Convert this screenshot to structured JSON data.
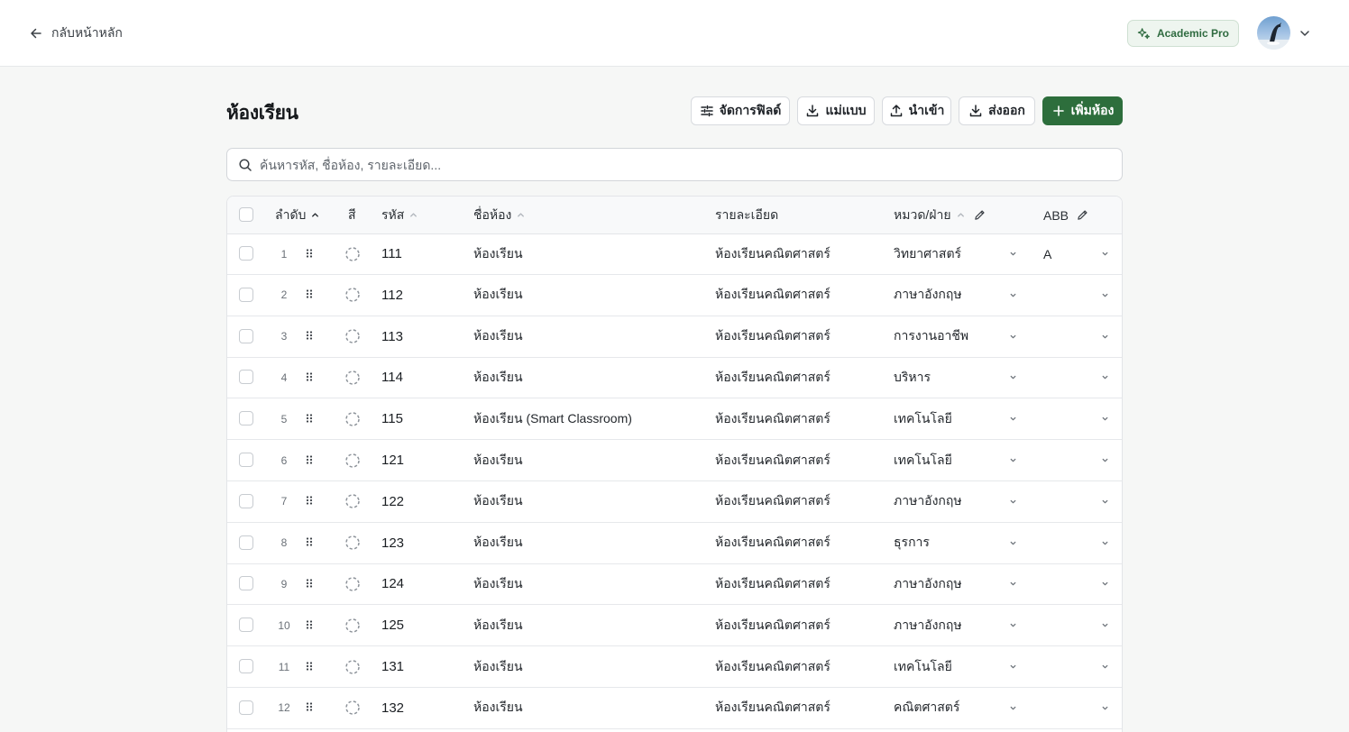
{
  "topbar": {
    "back_label": "กลับหน้าหลัก",
    "plan_label": "Academic Pro",
    "avatar_alt": "avatar"
  },
  "page": {
    "title": "ห้องเรียน",
    "buttons": {
      "manage_fields": "จัดการฟิลด์",
      "template": "แม่แบบ",
      "import": "นำเข้า",
      "export": "ส่งออก",
      "add_room": "เพิ่มห้อง"
    },
    "search_placeholder": "ค้นหารหัส, ชื่อห้อง, รายละเอียด..."
  },
  "table": {
    "headers": {
      "order": "ลำดับ",
      "color": "สี",
      "code": "รหัส",
      "name": "ชื่อห้อง",
      "description": "รายละเอียด",
      "department": "หมวด/ฝ่าย",
      "abb": "ABB"
    },
    "rows": [
      {
        "order": "1",
        "code": "111",
        "name": "ห้องเรียน",
        "description": "ห้องเรียนคณิตศาสตร์",
        "department": "วิทยาศาสตร์",
        "abb": "A"
      },
      {
        "order": "2",
        "code": "112",
        "name": "ห้องเรียน",
        "description": "ห้องเรียนคณิตศาสตร์",
        "department": "ภาษาอังกฤษ",
        "abb": ""
      },
      {
        "order": "3",
        "code": "113",
        "name": "ห้องเรียน",
        "description": "ห้องเรียนคณิตศาสตร์",
        "department": "การงานอาชีพ",
        "abb": ""
      },
      {
        "order": "4",
        "code": "114",
        "name": "ห้องเรียน",
        "description": "ห้องเรียนคณิตศาสตร์",
        "department": "บริหาร",
        "abb": ""
      },
      {
        "order": "5",
        "code": "115",
        "name": "ห้องเรียน (Smart Classroom)",
        "description": "ห้องเรียนคณิตศาสตร์",
        "department": "เทคโนโลยี",
        "abb": ""
      },
      {
        "order": "6",
        "code": "121",
        "name": "ห้องเรียน",
        "description": "ห้องเรียนคณิตศาสตร์",
        "department": "เทคโนโลยี",
        "abb": ""
      },
      {
        "order": "7",
        "code": "122",
        "name": "ห้องเรียน",
        "description": "ห้องเรียนคณิตศาสตร์",
        "department": "ภาษาอังกฤษ",
        "abb": ""
      },
      {
        "order": "8",
        "code": "123",
        "name": "ห้องเรียน",
        "description": "ห้องเรียนคณิตศาสตร์",
        "department": "ธุรการ",
        "abb": ""
      },
      {
        "order": "9",
        "code": "124",
        "name": "ห้องเรียน",
        "description": "ห้องเรียนคณิตศาสตร์",
        "department": "ภาษาอังกฤษ",
        "abb": ""
      },
      {
        "order": "10",
        "code": "125",
        "name": "ห้องเรียน",
        "description": "ห้องเรียนคณิตศาสตร์",
        "department": "ภาษาอังกฤษ",
        "abb": ""
      },
      {
        "order": "11",
        "code": "131",
        "name": "ห้องเรียน",
        "description": "ห้องเรียนคณิตศาสตร์",
        "department": "เทคโนโลยี",
        "abb": ""
      },
      {
        "order": "12",
        "code": "132",
        "name": "ห้องเรียน",
        "description": "ห้องเรียนคณิตศาสตร์",
        "department": "คณิตศาสตร์",
        "abb": ""
      }
    ]
  },
  "icons": {
    "back": "arrow-left-icon",
    "plan": "sparkle-icon",
    "manage_fields": "sliders-icon",
    "template": "download-icon",
    "import": "upload-icon",
    "export": "download-icon",
    "add": "plus-icon",
    "search": "search-icon",
    "drag": "drag-handle-icon",
    "color": "dashed-circle-icon"
  },
  "colors": {
    "primary": "#2d6e3c",
    "badge_bg": "#eef5ef",
    "badge_text": "#2f6b40"
  }
}
